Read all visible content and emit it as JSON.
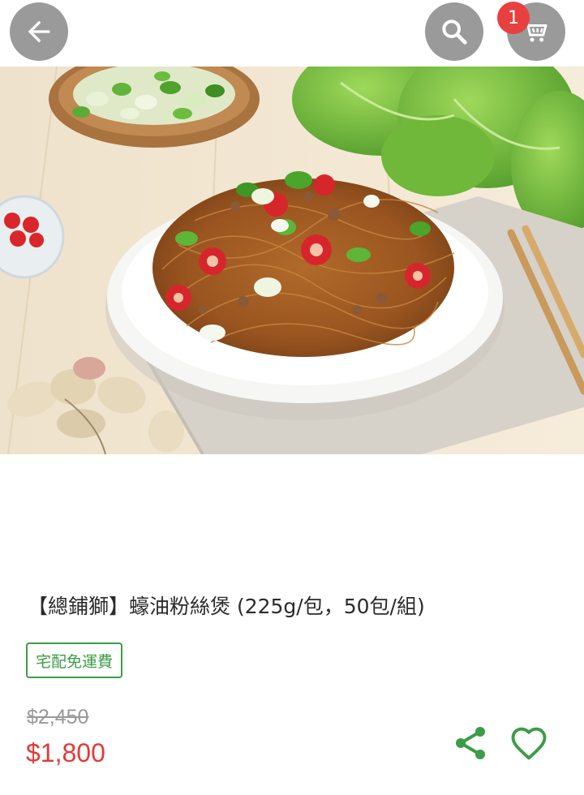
{
  "header": {
    "back_icon": "arrow-left-icon",
    "search_icon": "search-icon",
    "cart_icon": "cart-icon",
    "cart_count": "1"
  },
  "product": {
    "title": "【總鋪獅】蠔油粉絲煲 (225g/包，50包/組)",
    "shipping_tag": "宅配免運費",
    "original_price": "$2,450",
    "price": "$1,800"
  },
  "actions": {
    "share_icon": "share-icon",
    "favorite_icon": "heart-outline-icon"
  },
  "colors": {
    "accent_green": "#3c9c48",
    "price_red": "#e53935",
    "badge_red": "#e8403f",
    "button_gray": "#9a9a9a"
  }
}
